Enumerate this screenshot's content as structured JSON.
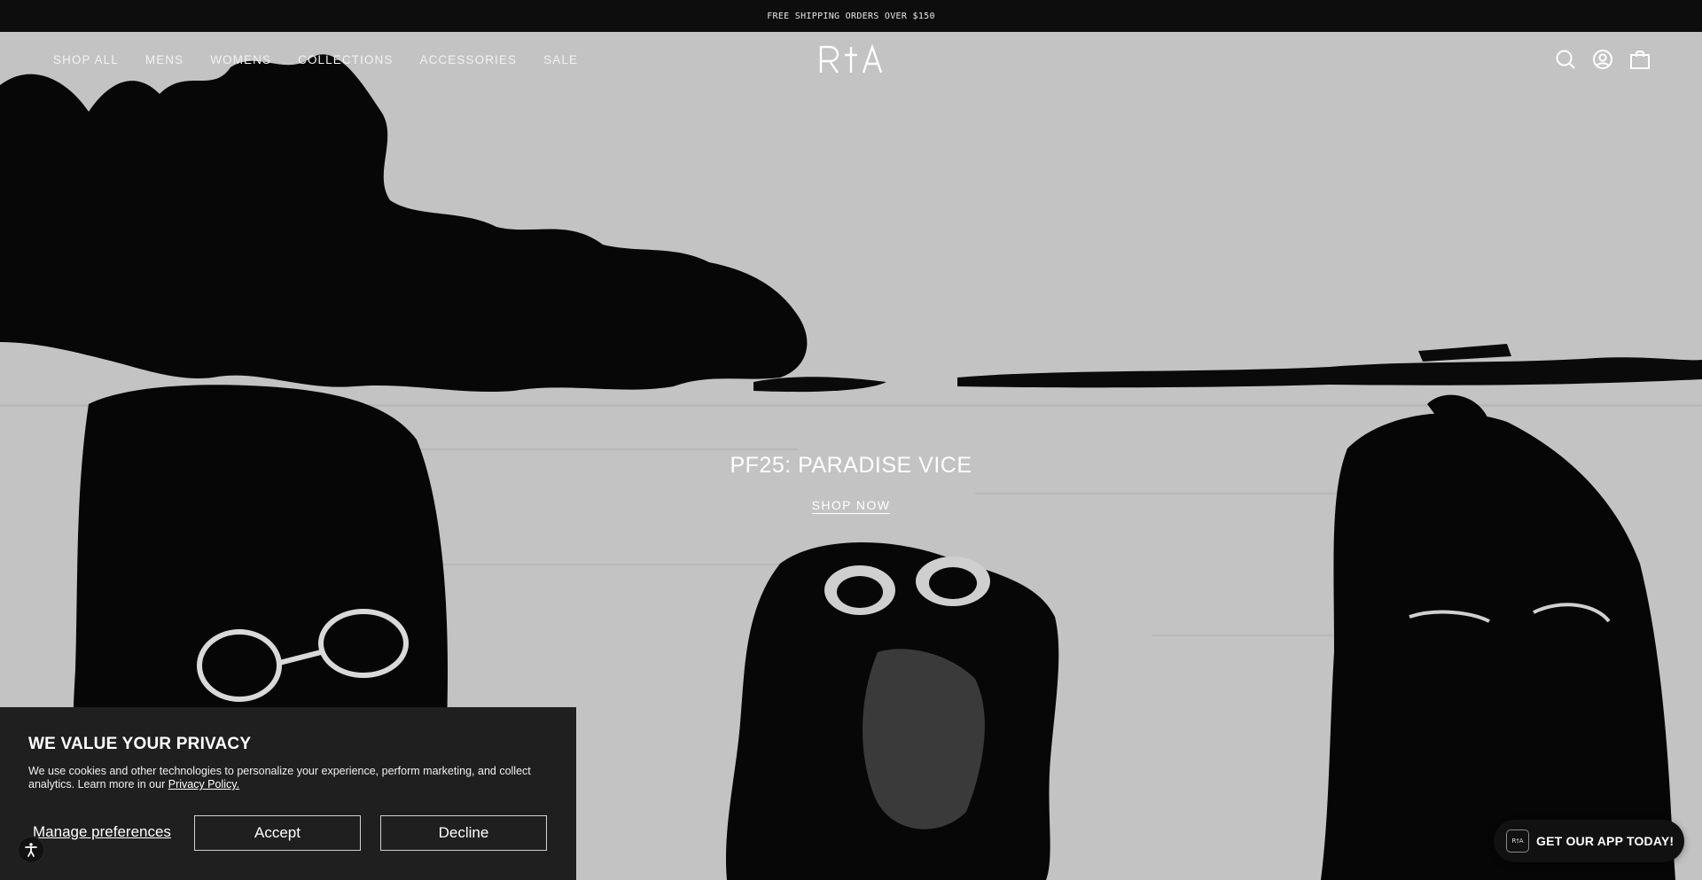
{
  "announcement": {
    "text": "FREE SHIPPING ORDERS OVER $150"
  },
  "nav": {
    "items": [
      "SHOP ALL",
      "MENS",
      "WOMENS",
      "COLLECTIONS",
      "ACCESSORIES",
      "SALE"
    ]
  },
  "brand": {
    "logo_text": "R†A"
  },
  "header_icons": [
    "search-icon",
    "account-icon",
    "cart-icon"
  ],
  "hero": {
    "title": "PF25: PARADISE VICE",
    "cta": "SHOP NOW"
  },
  "privacy": {
    "title": "WE VALUE YOUR PRIVACY",
    "body": "We use cookies and other technologies to personalize your experience, perform marketing, and collect analytics. Learn more in our",
    "policy_link": "Privacy Policy.",
    "manage_label": "Manage preferences",
    "accept_label": "Accept",
    "decline_label": "Decline"
  },
  "accessibility": {
    "icon": "accessibility-icon"
  },
  "app_promo": {
    "logo_text": "R†A",
    "label": "GET OUR APP TODAY!"
  },
  "colors": {
    "bar": "#0d0d0d",
    "hero_bg": "#c3c3c3",
    "panel": "#1f1f1f",
    "text_light": "#ffffff"
  }
}
